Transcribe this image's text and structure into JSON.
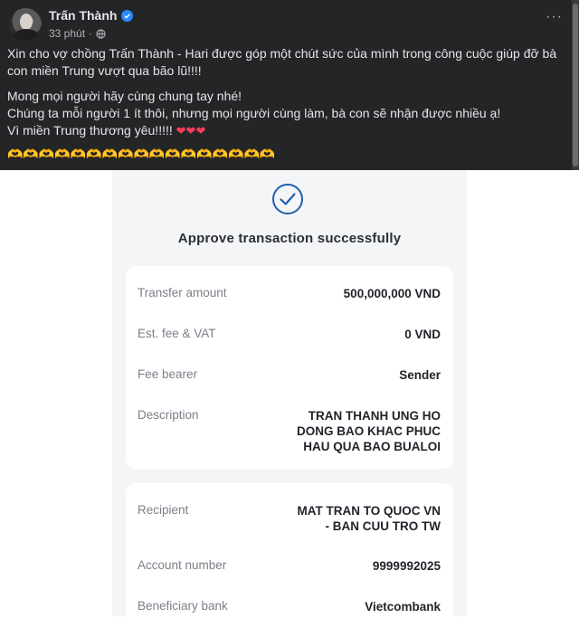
{
  "post": {
    "author": "Trấn Thành",
    "time": "33 phút",
    "separator": "·",
    "text_p1": "Xin cho vợ chồng Trấn Thành - Hari được góp một chút sức của mình trong công cuộc giúp đỡ bà con miền Trung vượt qua bão lũ!!!!",
    "text_p2_line1": "Mong mọi người hãy cùng chung tay nhé!",
    "text_p2_line2": "Chúng ta mỗi người 1 ít thôi, nhưng mọi người cùng làm, bà con sẽ nhận được nhiều ạ!",
    "text_p2_line3": "Vì miền Trung thương yêu!!!!! ",
    "hearts": "❤❤❤",
    "emoji_row": "🫶🫶🫶🫶🫶🫶🫶🫶🫶🫶🫶🫶🫶🫶🫶🫶🫶",
    "more_label": "···"
  },
  "receipt": {
    "title": "Approve transaction successfully",
    "details": [
      {
        "label": "Transfer amount",
        "value": "500,000,000 VND"
      },
      {
        "label": "Est. fee & VAT",
        "value": "0 VND"
      },
      {
        "label": "Fee bearer",
        "value": "Sender"
      },
      {
        "label": "Description",
        "value_lines": [
          "TRAN THANH UNG HO",
          "DONG BAO KHAC PHUC",
          "HAU QUA BAO BUALOI"
        ]
      }
    ],
    "recipient": [
      {
        "label": "Recipient",
        "value_lines": [
          "MAT TRAN TO QUOC VN",
          "- BAN CUU TRO TW"
        ]
      },
      {
        "label": "Account number",
        "value": "9999992025"
      },
      {
        "label": "Beneficiary bank",
        "value": "Vietcombank"
      }
    ]
  },
  "colors": {
    "fb_background": "#242526",
    "fb_text": "#e4e6eb",
    "verified": "#2d88ff",
    "receipt_background": "#f4f5f7",
    "check_accent": "#1f5fae"
  },
  "icons": [
    "verified-icon",
    "globe-icon",
    "more-options-icon",
    "success-check-icon"
  ]
}
